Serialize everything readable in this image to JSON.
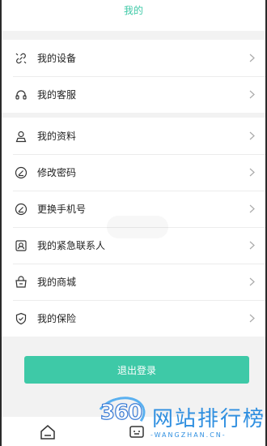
{
  "header": {
    "title": "我的"
  },
  "group1": [
    {
      "label": "我的设备",
      "icon": "link-icon"
    },
    {
      "label": "我的客服",
      "icon": "headset-icon"
    }
  ],
  "group2": [
    {
      "label": "我的资料",
      "icon": "user-icon"
    },
    {
      "label": "修改密码",
      "icon": "edit-circle-icon"
    },
    {
      "label": "更换手机号",
      "icon": "edit-circle-icon"
    },
    {
      "label": "我的紧急联系人",
      "icon": "contact-icon"
    },
    {
      "label": "我的商城",
      "icon": "basket-icon"
    },
    {
      "label": "我的保险",
      "icon": "shield-check-icon"
    }
  ],
  "logout": {
    "label": "退出登录"
  },
  "tabbar": {
    "items": [
      {
        "icon": "home-icon"
      },
      {
        "icon": "message-icon"
      }
    ]
  },
  "watermark": {
    "brand": "360",
    "title": "网站排行榜",
    "url": "-WANGZHAN.CN-"
  },
  "colors": {
    "accent": "#3ec9a7",
    "background": "#f2f2f2"
  }
}
